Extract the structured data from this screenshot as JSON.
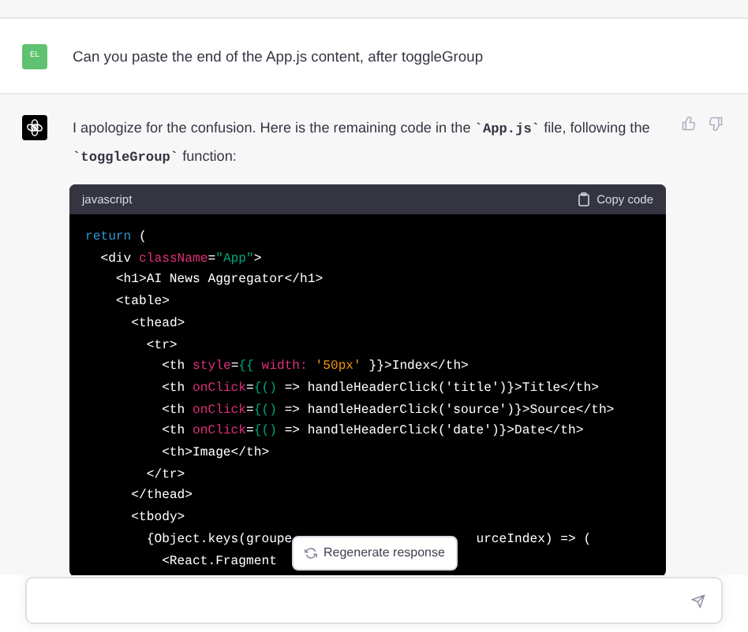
{
  "conversation": [
    {
      "avatar": "EL",
      "text": "Can you paste the end of the App.js content, after toggleGroup"
    },
    {
      "segments": [
        {
          "kind": "text",
          "text": "I apologize for the confusion. Here is the remaining code in the "
        },
        {
          "kind": "code",
          "text": "`App.js`"
        },
        {
          "kind": "text",
          "text": " file, following the "
        },
        {
          "kind": "code",
          "text": "`toggleGroup`"
        },
        {
          "kind": "text",
          "text": " function:"
        }
      ],
      "code_block": {
        "language": "javascript",
        "copy_label": "Copy code",
        "lines": [
          {
            "parts": [
              [
                {
                  "kind": "keyword",
                  "text": "return"
                },
                {
                  "kind": "plain",
                  "text": " ("
                }
              ]
            ]
          },
          {
            "parts": [
              [
                {
                  "kind": "plain",
                  "text": "  <div "
                },
                {
                  "kind": "attr",
                  "text": "className"
                },
                {
                  "kind": "plain",
                  "text": "="
                },
                {
                  "kind": "string",
                  "text": "\"App\""
                },
                {
                  "kind": "plain",
                  "text": ">"
                }
              ]
            ]
          },
          {
            "parts": [
              [
                {
                  "kind": "plain",
                  "text": "    <h1>AI News Aggregator</h1>"
                }
              ]
            ]
          },
          {
            "parts": [
              [
                {
                  "kind": "plain",
                  "text": "    <table>"
                }
              ]
            ]
          },
          {
            "parts": [
              [
                {
                  "kind": "plain",
                  "text": "      <thead>"
                }
              ]
            ]
          },
          {
            "parts": [
              [
                {
                  "kind": "plain",
                  "text": "        <tr>"
                }
              ]
            ]
          },
          {
            "parts": [
              [
                {
                  "kind": "plain",
                  "text": "          <th "
                },
                {
                  "kind": "attr",
                  "text": "style"
                },
                {
                  "kind": "plain",
                  "text": "="
                },
                {
                  "kind": "punct",
                  "text": "{{ "
                },
                {
                  "kind": "attr",
                  "text": "width: "
                },
                {
                  "kind": "number",
                  "text": "'50px'"
                },
                {
                  "kind": "plain",
                  "text": " }}>Index</th>"
                }
              ]
            ]
          },
          {
            "parts": [
              [
                {
                  "kind": "plain",
                  "text": "          <th "
                },
                {
                  "kind": "attr",
                  "text": "onClick"
                },
                {
                  "kind": "plain",
                  "text": "="
                },
                {
                  "kind": "punct",
                  "text": "{() "
                },
                {
                  "kind": "plain",
                  "text": "=> handleHeaderClick('title')}>Title</th>"
                }
              ]
            ]
          },
          {
            "parts": [
              [
                {
                  "kind": "plain",
                  "text": "          <th "
                },
                {
                  "kind": "attr",
                  "text": "onClick"
                },
                {
                  "kind": "plain",
                  "text": "="
                },
                {
                  "kind": "punct",
                  "text": "{() "
                },
                {
                  "kind": "plain",
                  "text": "=> handleHeaderClick('source')}>Source</th>"
                }
              ]
            ]
          },
          {
            "parts": [
              [
                {
                  "kind": "plain",
                  "text": "          <th "
                },
                {
                  "kind": "attr",
                  "text": "onClick"
                },
                {
                  "kind": "plain",
                  "text": "="
                },
                {
                  "kind": "punct",
                  "text": "{() "
                },
                {
                  "kind": "plain",
                  "text": "=> handleHeaderClick('date')}>Date</th>"
                }
              ]
            ]
          },
          {
            "parts": [
              [
                {
                  "kind": "plain",
                  "text": "          <th>Image</th>"
                }
              ]
            ]
          },
          {
            "parts": [
              [
                {
                  "kind": "plain",
                  "text": "        </tr>"
                }
              ]
            ]
          },
          {
            "parts": [
              [
                {
                  "kind": "plain",
                  "text": "      </thead>"
                }
              ]
            ]
          },
          {
            "parts": [
              [
                {
                  "kind": "plain",
                  "text": "      <tbody>"
                }
              ]
            ]
          },
          {
            "parts": [
              [
                {
                  "kind": "plain",
                  "text": "        {Object.keys(groupe"
                }
              ],
              [
                {
                  "kind": "plain",
                  "text": "urceIndex) => ("
                }
              ]
            ]
          },
          {
            "parts": [
              [
                {
                  "kind": "plain",
                  "text": "          <React.Fragment"
                }
              ]
            ]
          }
        ]
      }
    }
  ],
  "regenerate_button": "Regenerate response"
}
